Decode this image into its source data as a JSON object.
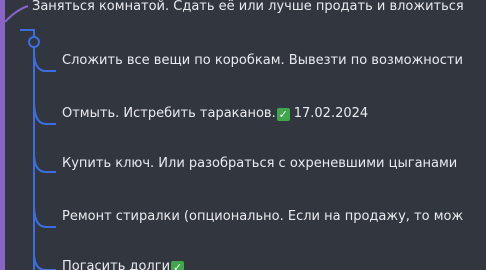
{
  "mindmap": {
    "parent": {
      "label": "Заняться комнатой. Сдать её или лучше продать и вложиться"
    },
    "children": [
      {
        "label": "Сложить все вещи по коробкам. Вывезти по возможности"
      },
      {
        "label": "Отмыть. Истребить тараканов.",
        "done_mark": "✓",
        "date": "17.02.2024"
      },
      {
        "label": "Купить ключ. Или разобраться с охреневшими цыганами"
      },
      {
        "label": "Ремонт стиралки (опционально. Если на продажу, то мож"
      },
      {
        "label": "Погасить долги",
        "done_mark": "✓"
      }
    ],
    "colors": {
      "background": "#32363f",
      "connector": "#3b6fe0",
      "parent_bar": "#8a63c9",
      "check": "#3fa64a",
      "text": "#e9ebef"
    }
  }
}
